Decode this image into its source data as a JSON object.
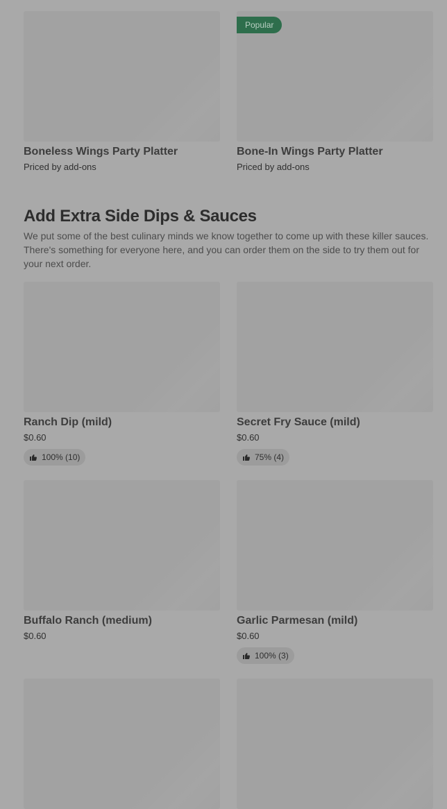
{
  "platters": [
    {
      "title": "Boneless Wings Party Platter",
      "subtitle": "Priced by add-ons",
      "badge": ""
    },
    {
      "title": "Bone-In Wings Party Platter",
      "subtitle": "Priced by add-ons",
      "badge": "Popular"
    }
  ],
  "section": {
    "title": "Add Extra Side Dips & Sauces",
    "description": "We put some of the best culinary minds we know together to come up with these killer sauces. There's something for everyone here, and you can order them on the side to try them out for your next order."
  },
  "items": [
    {
      "title": "Ranch Dip (mild)",
      "price": "$0.60",
      "rating": "100% (10)"
    },
    {
      "title": "Secret Fry Sauce (mild)",
      "price": "$0.60",
      "rating": "75% (4)"
    },
    {
      "title": "Buffalo Ranch (medium)",
      "price": "$0.60",
      "rating": ""
    },
    {
      "title": "Garlic Parmesan (mild)",
      "price": "$0.60",
      "rating": "100% (3)"
    }
  ],
  "icons": {
    "rating": "thumbs-up-icon"
  },
  "colors": {
    "badge_bg": "#2e6e4c",
    "overlay_bg": "#a9a9a9"
  }
}
